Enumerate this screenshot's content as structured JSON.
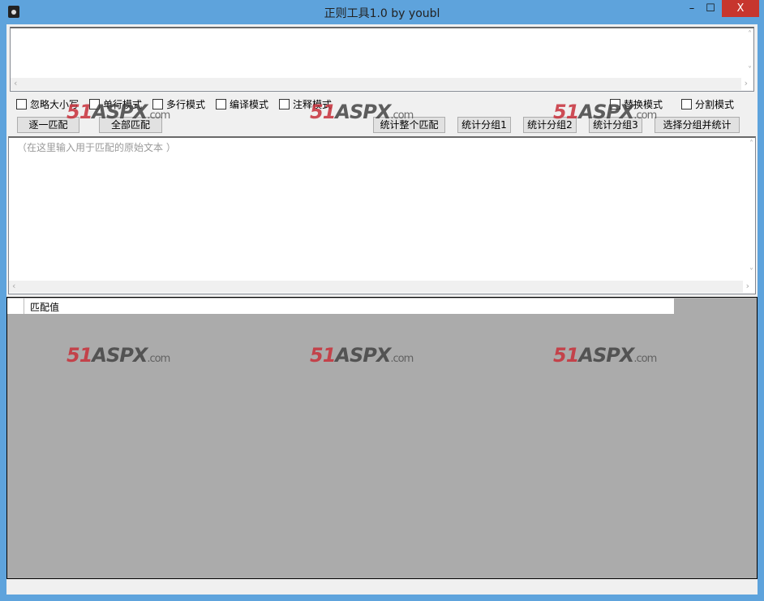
{
  "window": {
    "title": "正则工具1.0 by youbl",
    "minimize": "–",
    "maximize": "☐",
    "close": "X"
  },
  "pattern_input": {
    "value": ""
  },
  "options": [
    "忽略大小写",
    "单行模式",
    "多行模式",
    "编译模式",
    "注释模式",
    "替换模式",
    "分割模式"
  ],
  "buttons": [
    "逐一匹配",
    "全部匹配",
    "统计整个匹配",
    "统计分组1",
    "统计分组2",
    "统计分组3",
    "选择分组并统计"
  ],
  "source_input": {
    "placeholder": "（在这里输入用于匹配的原始文本 ）"
  },
  "grid": {
    "column_header": "匹配值"
  },
  "watermark": {
    "num": "51",
    "brand": "ASPX",
    ".com": ".com"
  }
}
